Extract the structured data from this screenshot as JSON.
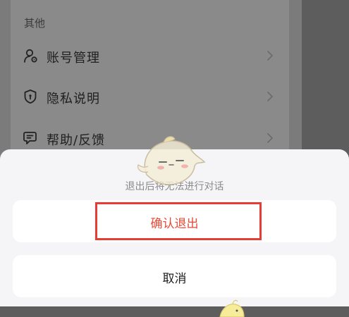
{
  "settings": {
    "section_title": "其他",
    "items": [
      {
        "label": "账号管理",
        "icon": "user-gear-icon"
      },
      {
        "label": "隐私说明",
        "icon": "shield-icon"
      },
      {
        "label": "帮助/反馈",
        "icon": "feedback-icon"
      }
    ]
  },
  "sheet": {
    "hint": "退出后将无法进行对话",
    "confirm_label": "确认退出",
    "cancel_label": "取消"
  },
  "colors": {
    "confirm": "#e74b36",
    "highlight": "#e53c35"
  }
}
